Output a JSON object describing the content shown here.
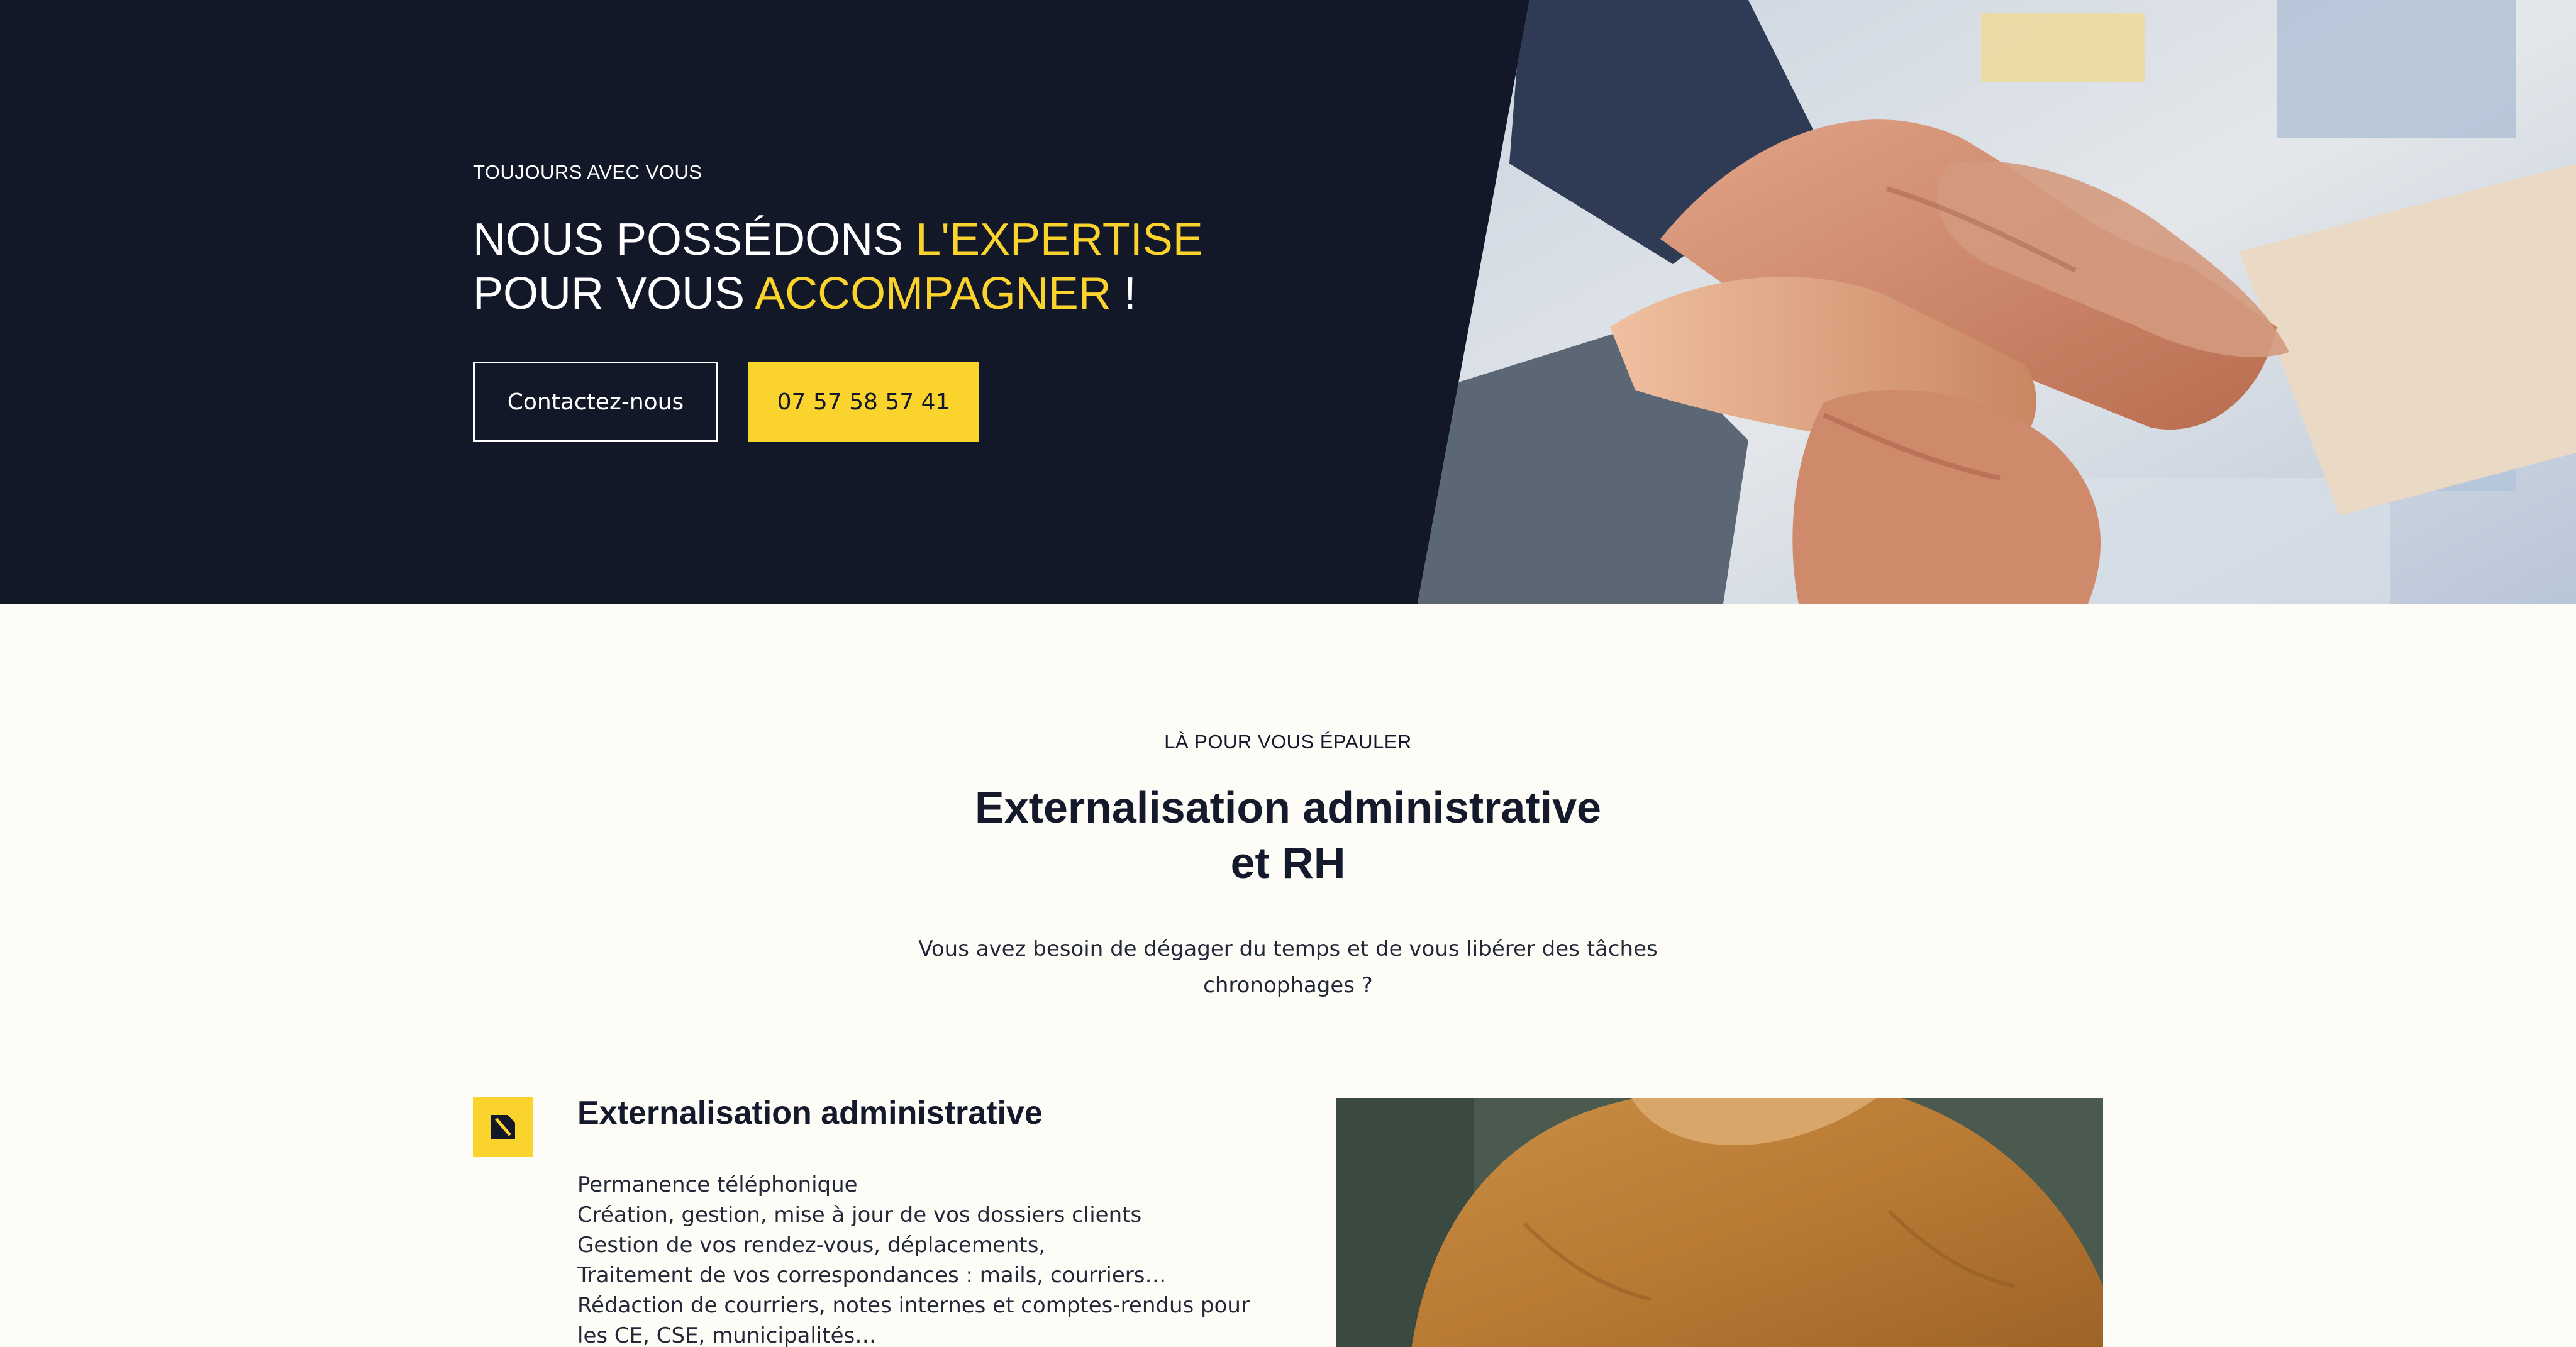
{
  "hero": {
    "eyebrow": "TOUJOURS AVEC VOUS",
    "title_line1_part1": "NOUS POSSÉDONS ",
    "title_line1_accent": "L'EXPERTISE",
    "title_line2_part1": "POUR VOUS ",
    "title_line2_accent": "ACCOMPAGNER",
    "title_line2_end": " !",
    "contact_button": "Contactez-nous",
    "phone_button": "07 57 58 57 41"
  },
  "section": {
    "eyebrow": "LÀ POUR VOUS ÉPAULER",
    "title_line1": "Externalisation administrative",
    "title_line2": "et RH",
    "lead_line1": "Vous avez besoin de dégager du temps et de vous libérer des tâches",
    "lead_line2": "chronophages ?"
  },
  "feature": {
    "icon": "document-icon",
    "title": "Externalisation administrative",
    "items": [
      "Permanence téléphonique",
      "Création, gestion, mise à jour de vos dossiers clients",
      "Gestion de vos rendez-vous, déplacements,",
      "Traitement de vos correspondances : mails, courriers…",
      "Rédaction de courriers, notes internes et comptes-rendus pour",
      "les CE, CSE, municipalités…"
    ]
  },
  "colors": {
    "navy": "#131829",
    "accent_yellow": "#fbd32d",
    "cream": "#fdfcf7"
  }
}
